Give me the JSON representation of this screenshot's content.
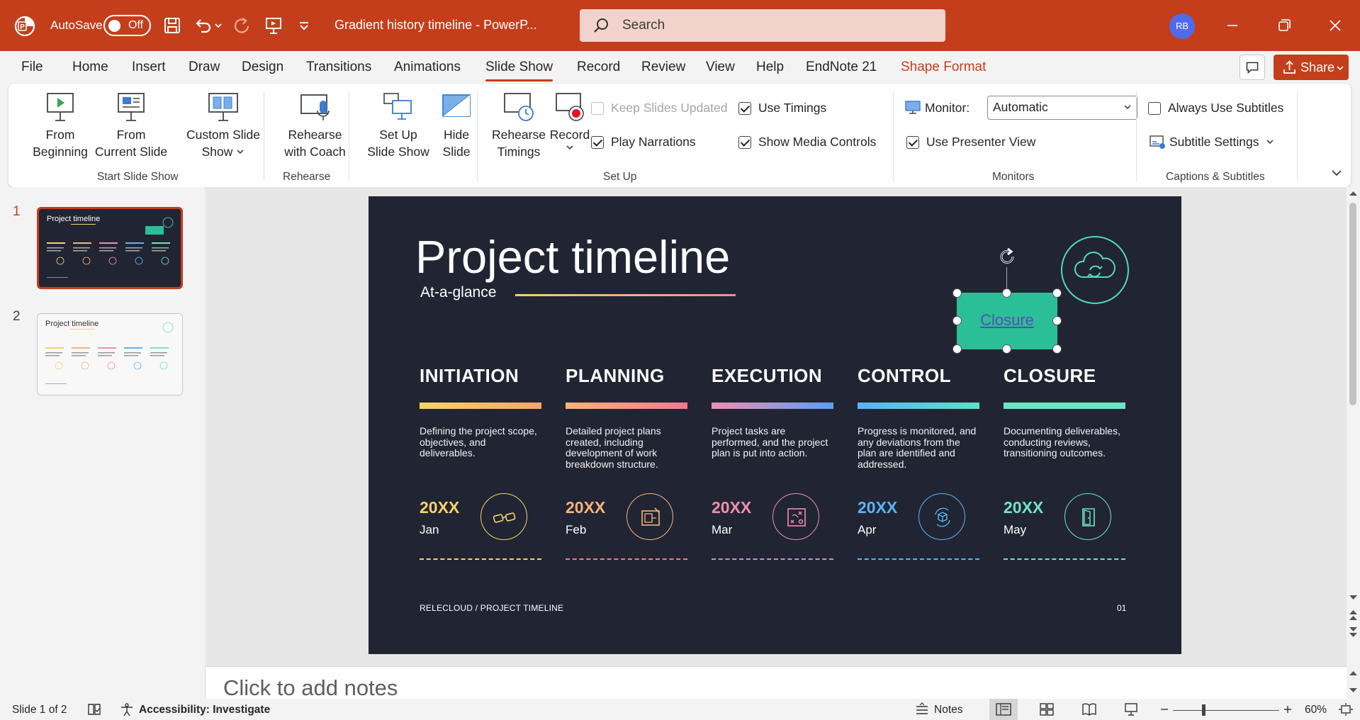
{
  "titlebar": {
    "autosave_label": "AutoSave",
    "autosave_state": "Off",
    "doc_title": "Gradient history timeline  -  PowerP...",
    "search_placeholder": "Search",
    "user_initials": "RB"
  },
  "menu": {
    "tabs": [
      "File",
      "Home",
      "Insert",
      "Draw",
      "Design",
      "Transitions",
      "Animations",
      "Slide Show",
      "Record",
      "Review",
      "View",
      "Help",
      "EndNote 21",
      "Shape Format"
    ],
    "active_tab": "Slide Show",
    "share_label": "Share"
  },
  "ribbon": {
    "start": {
      "from_beginning": [
        "From",
        "Beginning"
      ],
      "from_current": [
        "From",
        "Current Slide"
      ],
      "custom": [
        "Custom Slide",
        "Show"
      ],
      "group_label": "Start Slide Show"
    },
    "rehearse": {
      "coach": [
        "Rehearse",
        "with Coach"
      ],
      "group_label": "Rehearse"
    },
    "setup": {
      "setup_show": [
        "Set Up",
        "Slide Show"
      ],
      "hide_slide": [
        "Hide",
        "Slide"
      ],
      "rehearse_timings": [
        "Rehearse",
        "Timings"
      ],
      "record": "Record",
      "keep_updated": "Keep Slides Updated",
      "play_narrations": "Play Narrations",
      "use_timings": "Use Timings",
      "show_media": "Show Media Controls",
      "group_label": "Set Up"
    },
    "monitors": {
      "monitor_label": "Monitor:",
      "monitor_value": "Automatic",
      "presenter_view": "Use Presenter View",
      "group_label": "Monitors"
    },
    "captions": {
      "always_subtitles": "Always Use Subtitles",
      "subtitle_settings": "Subtitle Settings",
      "group_label": "Captions & Subtitles"
    }
  },
  "thumbnails": [
    {
      "number": "1",
      "title": "Project timeline",
      "variant": "dark"
    },
    {
      "number": "2",
      "title": "Project timeline",
      "variant": "light"
    }
  ],
  "slide": {
    "title": "Project timeline",
    "subtitle": "At-a-glance",
    "selected_shape_text": "Closure",
    "phases": [
      {
        "title": "INITIATION",
        "desc": "Defining the project scope, objectives, and deliverables.",
        "year": "20XX",
        "month": "Jan",
        "color": "#f7d36b",
        "bar_to": "#f7a56b"
      },
      {
        "title": "PLANNING",
        "desc": "Detailed project plans created, including development of work breakdown structure.",
        "year": "20XX",
        "month": "Feb",
        "color": "#f8b27a",
        "bar_to": "#f07c8f"
      },
      {
        "title": "EXECUTION",
        "desc": "Project tasks are performed, and the project plan is put into action.",
        "year": "20XX",
        "month": "Mar",
        "color": "#f08eb0",
        "bar_to": "#5aa0f5"
      },
      {
        "title": "CONTROL",
        "desc": "Progress is monitored, and any deviations from the plan are identified and addressed.",
        "year": "20XX",
        "month": "Apr",
        "color": "#5ab4f5",
        "bar_to": "#5fe0c9"
      },
      {
        "title": "CLOSURE",
        "desc": "Documenting deliverables, conducting reviews, transitioning outcomes.",
        "year": "20XX",
        "month": "May",
        "color": "#6fe4c4",
        "bar_to": "#6fe4c4"
      }
    ],
    "footer_left": "RELECLOUD / PROJECT TIMELINE",
    "footer_right": "01"
  },
  "notes": {
    "placeholder": "Click to add notes"
  },
  "status": {
    "slide_count": "Slide 1 of 2",
    "accessibility": "Accessibility: Investigate",
    "notes_label": "Notes",
    "zoom": "60%"
  },
  "colors": {
    "accent": "#c43e1c",
    "slide_bg": "#212533",
    "selected_shape": "#2bbf97"
  }
}
